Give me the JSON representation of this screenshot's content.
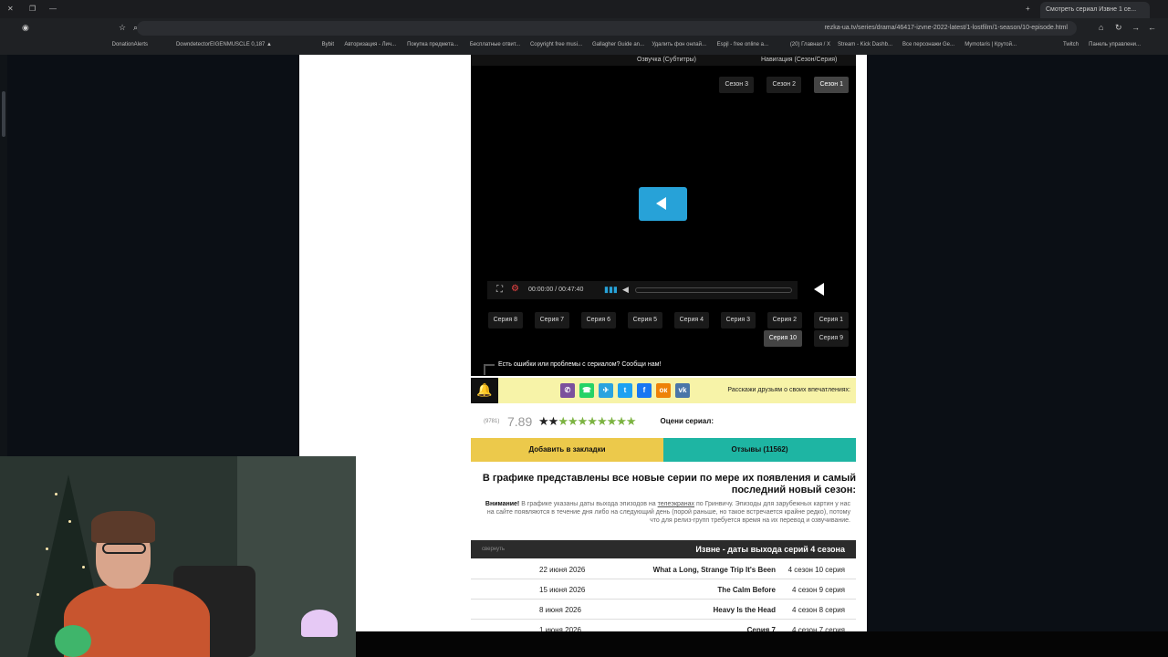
{
  "browser": {
    "tab_title": "Смотреть сериал Извне 1 се...",
    "url": "rezka-ua.tv/series/drama/46417-izvne-2022-latest/1-lostfilm/1-season/10-episode.html",
    "bookmarks": [
      "Панель управлени...",
      "Twitch",
      "Mymotaris | Крутой...",
      "Все персонажи Ge...",
      "Stream - Kick Dashb...",
      "(20) Главная / X",
      "Espjl - free online a...",
      "Удалить фон онлай...",
      "Gallagher Guide an...",
      "Copyright free musi...",
      "Бесплатные отвит...",
      "Покупка предмета...",
      "Авторизация - Лич...",
      "Bybit",
      "EIGENMUSCLE 0,187 ▲",
      "Downdetector",
      "DonationAlerts"
    ]
  },
  "player": {
    "top_left": "Озвучка (Субтитры)",
    "top_right": "Навигация (Сезон/Серия)",
    "seasons": [
      "Сезон 1",
      "Сезон 2",
      "Сезон 3"
    ],
    "time": "00:00:00 / 00:47:40",
    "episodes_row1": [
      "Серия 1",
      "Серия 2",
      "Серия 3",
      "Серия 4",
      "Серия 5",
      "Серия 6",
      "Серия 7",
      "Серия 8"
    ],
    "episodes_row2": [
      "Серия 9",
      "Серия 10"
    ],
    "error_text": "Есть ошибки или проблемы с сериалом? Сообщи нам!"
  },
  "share": {
    "text": "Расскажи друзьям о своих впечатлениях:",
    "icons": [
      "vk-icon",
      "odnoklassniki-icon",
      "facebook-icon",
      "twitter-icon",
      "telegram-icon",
      "whatsapp-icon",
      "viber-icon"
    ]
  },
  "rating": {
    "label": "Оцени сериал:",
    "score": "7.89",
    "votes": "(9781)",
    "stars_total": 10,
    "stars_on": 8
  },
  "buttons": {
    "reviews": "Отзывы (11562)",
    "bookmark": "Добавить в закладки"
  },
  "schedule": {
    "heading": "В графике представлены все новые серии по мере их появления и самый последний новый сезон:",
    "note_bold": "Внимание!",
    "note_text": "В графике указаны даты выхода эпизодов на",
    "note_link": "телеэкранах",
    "note_rest": "по Гринвичу. Эпизоды для зарубежных картин у нас на сайте появляются в течение дня либо на следующий день (порой раньше, но такое встречается крайне редко), потому что для релиз-групп требуется время на их перевод и озвучивание.",
    "table_title": "Извне - даты выхода серий 4 сезона",
    "collapse": "свернуть",
    "rows": [
      {
        "ep": "4 сезон 10 серия",
        "name": "What a Long, Strange Trip It's Been",
        "date": "22 июня 2026"
      },
      {
        "ep": "4 сезон 9 серия",
        "name": "The Calm Before",
        "date": "15 июня 2026"
      },
      {
        "ep": "4 сезон 8 серия",
        "name": "Heavy Is the Head",
        "date": "8 июня 2026"
      },
      {
        "ep": "4 сезон 7 серия",
        "name": "Серия 7",
        "date": "1 июня 2026"
      }
    ]
  }
}
